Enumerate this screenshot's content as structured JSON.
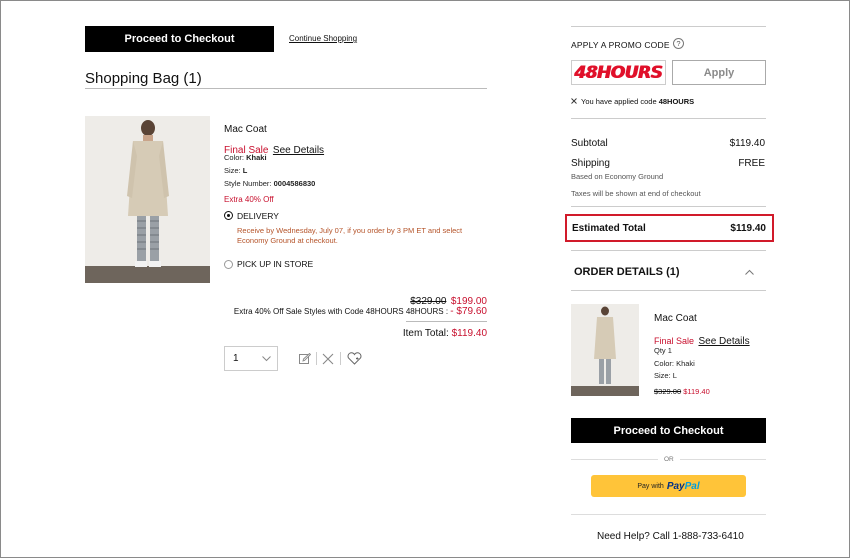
{
  "top": {
    "checkout_label": "Proceed to Checkout",
    "continue_label": "Continue Shopping"
  },
  "bag": {
    "title": "Shopping Bag (1)"
  },
  "item": {
    "name": "Mac Coat",
    "final_sale": "Final Sale",
    "see_details": "See Details",
    "color_label": "Color:",
    "color_value": "Khaki",
    "size_label": "Size:",
    "size_value": "L",
    "style_label": "Style Number:",
    "style_value": "0004586830",
    "discount": "Extra 40% Off",
    "delivery_label": "DELIVERY",
    "delivery_note_1": "Receive by Wednesday, July 07, if you order by 3 PM ET and select",
    "delivery_note_2": "Economy Ground at checkout.",
    "pickup_label": "PICK UP IN STORE",
    "orig_price": "$329.00",
    "sale_price": "$199.00",
    "promo_line": "Extra 40% Off Sale Styles with Code 48HOURS 48HOURS :",
    "promo_amount": "- $79.60",
    "total_label": "Item Total:",
    "total_value": "$119.40",
    "qty": "1"
  },
  "promo": {
    "title": "APPLY A PROMO CODE",
    "help": "?",
    "code_value": "48HOURS",
    "apply_label": "Apply",
    "applied_prefix": "You have applied code",
    "applied_code": "48HOURS"
  },
  "summary": {
    "subtotal_label": "Subtotal",
    "subtotal_value": "$119.40",
    "shipping_label": "Shipping",
    "shipping_value": "FREE",
    "shipping_sub": "Based on Economy Ground",
    "tax_note": "Taxes will be shown at end of checkout",
    "est_label": "Estimated Total",
    "est_value": "$119.40"
  },
  "order_details": {
    "title": "ORDER DETAILS (1)",
    "name": "Mac Coat",
    "final_sale": "Final Sale",
    "see_details": "See Details",
    "qty": "Qty 1",
    "color": "Color: Khaki",
    "size": "Size: L",
    "orig_price": "$329.00",
    "price": "$119.40"
  },
  "checkout2_label": "Proceed to Checkout",
  "or_label": "OR",
  "paypal": {
    "pay_with": "Pay with",
    "brand_1": "Pay",
    "brand_2": "Pal"
  },
  "help_text": "Need Help? Call 1-888-733-6410",
  "colors": {
    "accent_red": "#c8102e",
    "paypal_yellow": "#ffc439",
    "highlight_box": "#d11a2a"
  }
}
